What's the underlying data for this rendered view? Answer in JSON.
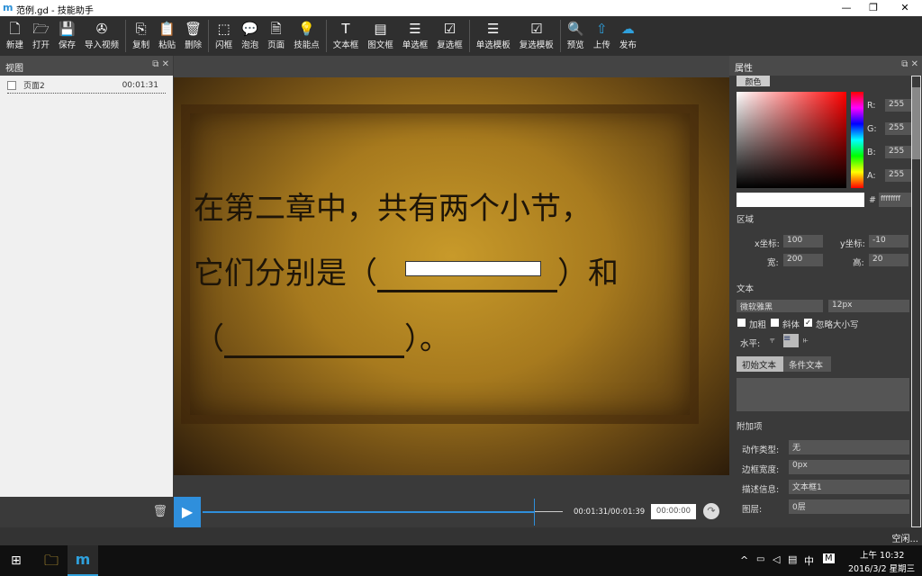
{
  "window": {
    "logo": "m",
    "title": "范例.gd - 技能助手",
    "minimize": "—",
    "restore": "❐",
    "close": "✕"
  },
  "toolbar": [
    {
      "label": "新建",
      "icon": "new-file-icon",
      "glyph": "🗋"
    },
    {
      "label": "打开",
      "icon": "open-folder-icon",
      "glyph": "🗁"
    },
    {
      "label": "保存",
      "icon": "save-icon",
      "glyph": "💾"
    },
    {
      "label": "导入视频",
      "icon": "film-reel-icon",
      "glyph": "✇"
    },
    {
      "sep": true
    },
    {
      "label": "复制",
      "icon": "copy-icon",
      "glyph": "⎘"
    },
    {
      "label": "粘贴",
      "icon": "paste-icon",
      "glyph": "📋"
    },
    {
      "label": "删除",
      "icon": "trash-icon",
      "glyph": "🗑"
    },
    {
      "sep": true
    },
    {
      "label": "闪框",
      "icon": "dashed-frame-icon",
      "glyph": "⬚"
    },
    {
      "label": "泡泡",
      "icon": "speech-bubble-icon",
      "glyph": "💬"
    },
    {
      "label": "页面",
      "icon": "page-icon",
      "glyph": "🗎"
    },
    {
      "label": "技能点",
      "icon": "lightbulb-icon",
      "glyph": "💡"
    },
    {
      "sep": true
    },
    {
      "label": "文本框",
      "icon": "text-icon",
      "glyph": "T"
    },
    {
      "label": "图文框",
      "icon": "image-text-icon",
      "glyph": "▤"
    },
    {
      "label": "单选框",
      "icon": "radio-list-icon",
      "glyph": "☰"
    },
    {
      "label": "复选框",
      "icon": "checklist-icon",
      "glyph": "☑"
    },
    {
      "sep": true
    },
    {
      "label": "单选模板",
      "icon": "radio-template-icon",
      "glyph": "☰"
    },
    {
      "label": "复选模板",
      "icon": "check-template-icon",
      "glyph": "☑"
    },
    {
      "sep": true
    },
    {
      "label": "预览",
      "icon": "search-icon",
      "glyph": "🔍",
      "blue": true
    },
    {
      "label": "上传",
      "icon": "upload-icon",
      "glyph": "⇧",
      "blue": true
    },
    {
      "label": "发布",
      "icon": "cloud-publish-icon",
      "glyph": "☁",
      "blue": true
    }
  ],
  "view_panel": {
    "title": "视图",
    "pages": [
      {
        "name": "页面2",
        "time": "00:01:31"
      }
    ]
  },
  "slide": {
    "line1": "在第二章中，共有两个小节，",
    "line2a": "它们分别是（",
    "line2b": "）和",
    "line3a": "（",
    "line3b": "）。"
  },
  "timeline": {
    "time": "00:01:31/00:01:39",
    "input": "00:00:00",
    "progress": 0.92
  },
  "properties": {
    "title": "属性",
    "color_tab": "颜色",
    "r_label": "R:",
    "r": "255",
    "g_label": "G:",
    "g": "255",
    "b_label": "B:",
    "b": "255",
    "a_label": "A:",
    "a": "255",
    "hash": "#",
    "hex": "ffffffff",
    "region_title": "区域",
    "x_label": "x坐标:",
    "x": "100",
    "y_label": "y坐标:",
    "y": "-10",
    "w_label": "宽:",
    "w": "200",
    "h_label": "高:",
    "h": "20",
    "text_title": "文本",
    "font": "微软雅黑",
    "size": "12px",
    "bold": "加粗",
    "italic": "斜体",
    "ignore_case": "忽略大小写",
    "align_label": "水平:",
    "tab_initial": "初始文本",
    "tab_condition": "条件文本",
    "extra_title": "附加项",
    "action_label": "动作类型:",
    "action": "无",
    "border_label": "边框宽度:",
    "border": "0px",
    "desc_label": "描述信息:",
    "desc": "文本框1",
    "layer_label": "图层:",
    "layer": "0层"
  },
  "status": "空闲...",
  "taskbar": {
    "ime": "中",
    "clock_time": "上午 10:32",
    "clock_date": "2016/3/2 星期三"
  }
}
